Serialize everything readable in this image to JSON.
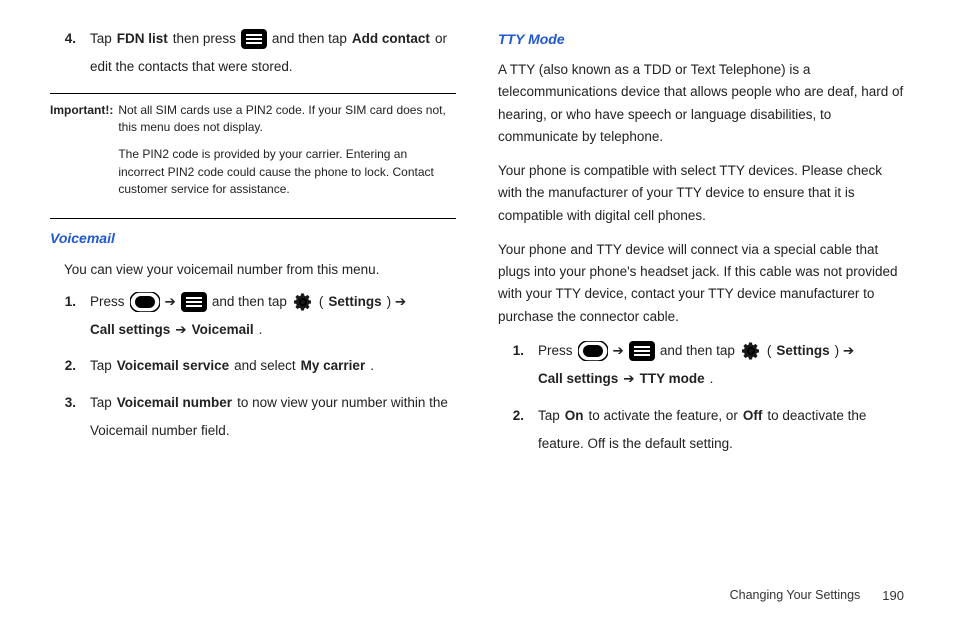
{
  "left": {
    "step4": {
      "num": "4.",
      "pre": "Tap",
      "fdn": "FDN list",
      "mid": "then press",
      "post": "and then tap",
      "add": "Add contact",
      "tail": "or",
      "line2": "edit the contacts that were stored."
    },
    "importantLabel": "Important!:",
    "important1": "Not all SIM cards use a PIN2 code. If your SIM card does not, this menu does not display.",
    "important2": "The PIN2 code is provided by your carrier. Entering an incorrect PIN2 code could cause the phone to lock. Contact customer service for assistance.",
    "voicemailHeading": "Voicemail",
    "voicemailIntro": "You can view your voicemail number from this menu.",
    "vm1": {
      "num": "1.",
      "press": "Press",
      "arrow1": "➔",
      "mid": "and then tap",
      "lparen": "(",
      "settings": "Settings",
      "rparenArrow": ") ➔",
      "call": "Call settings",
      "arrow2": " ➔ ",
      "voicemail": "Voicemail",
      "dot": "."
    },
    "vm2": {
      "num": "2.",
      "tap": "Tap",
      "svc": "Voicemail service",
      "sel": "and select",
      "carrier": "My carrier",
      "dot": "."
    },
    "vm3": {
      "num": "3.",
      "tap": "Tap",
      "vnum": "Voicemail number",
      "rest": "to now view your number within the",
      "line2": "Voicemail number field."
    }
  },
  "right": {
    "ttyHeading": "TTY Mode",
    "p1": "A TTY (also known as a TDD or Text Telephone) is a telecommunications device that allows people who are deaf, hard of hearing, or who have speech or language disabilities, to communicate by telephone.",
    "p2": "Your phone is compatible with select TTY devices. Please check with the manufacturer of your TTY device to ensure that it is compatible with digital cell phones.",
    "p3": "Your phone and TTY device will connect via a special cable that plugs into your phone's headset jack. If this cable was not provided with your TTY device, contact your TTY device manufacturer to purchase the connector cable.",
    "tty1": {
      "num": "1.",
      "press": "Press",
      "arrow1": "➔",
      "mid": "and then tap",
      "lparen": "(",
      "settings": "Settings",
      "rparenArrow": ") ➔",
      "call": "Call settings",
      "arrow2": " ➔ ",
      "ttymode": "TTY mode",
      "dot": "."
    },
    "tty2": {
      "num": "2.",
      "tap": "Tap",
      "on": "On",
      "mid": "to activate the feature, or",
      "off": "Off",
      "rest": "to deactivate the",
      "line2": "feature. Off is the default setting."
    }
  },
  "footer": {
    "title": "Changing Your Settings",
    "page": "190"
  }
}
